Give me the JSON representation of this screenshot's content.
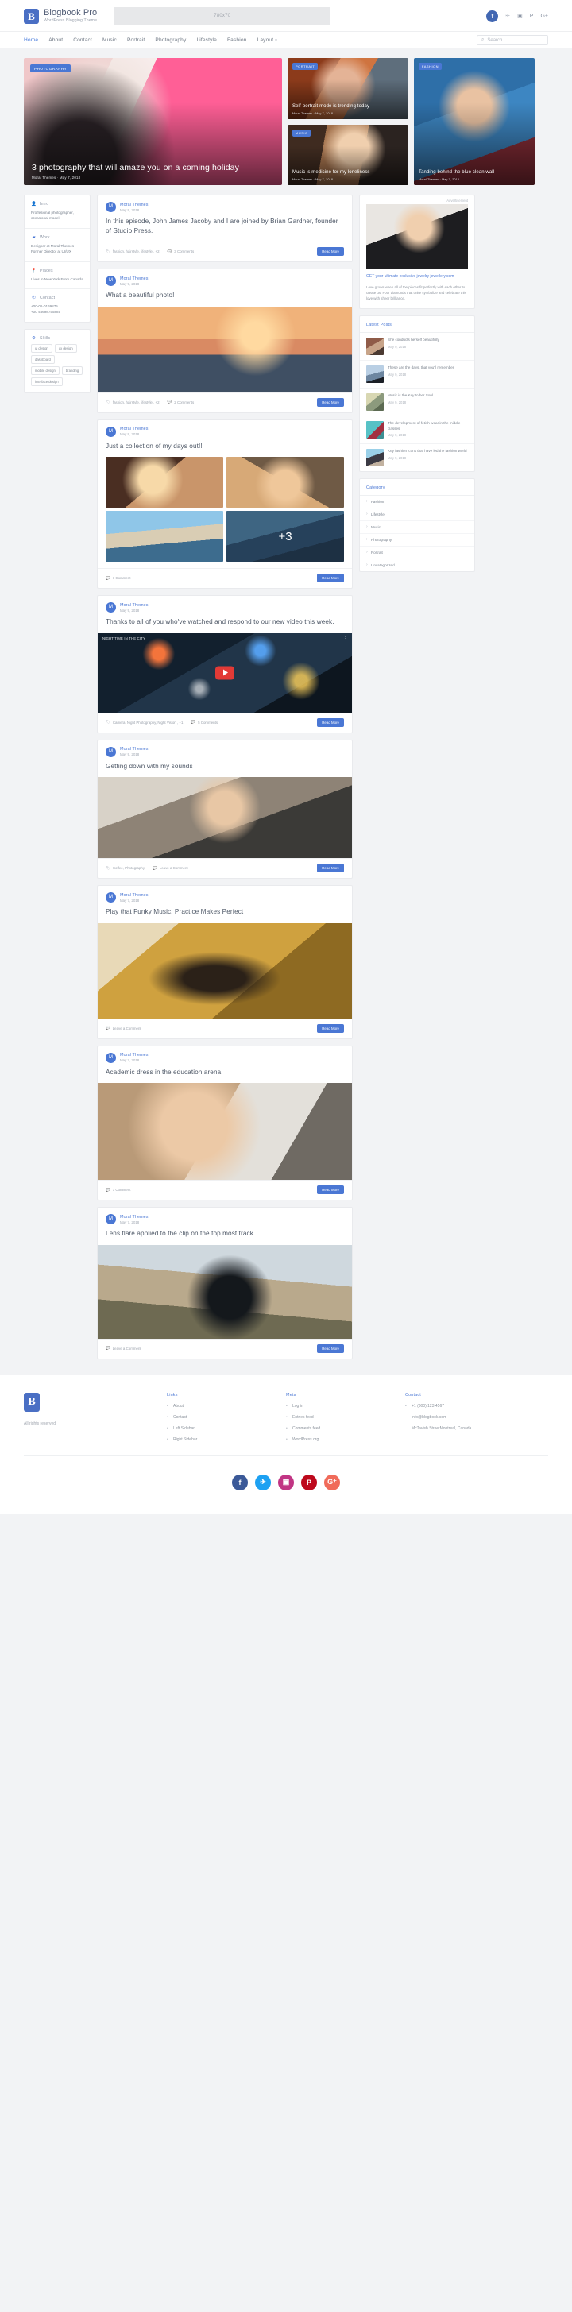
{
  "header": {
    "brand_title": "Blogbook Pro",
    "brand_sub": "WordPress Blogging Theme",
    "brand_mark": "B",
    "ad_placeholder": "780x70",
    "social": [
      {
        "name": "facebook-icon",
        "glyph": "f"
      },
      {
        "name": "twitter-icon",
        "glyph": "✈"
      },
      {
        "name": "instagram-icon",
        "glyph": "▣"
      },
      {
        "name": "pinterest-icon",
        "glyph": "P"
      },
      {
        "name": "google-plus-icon",
        "glyph": "G+"
      }
    ],
    "nav": [
      {
        "label": "Home",
        "active": true
      },
      {
        "label": "About",
        "active": false
      },
      {
        "label": "Contact",
        "active": false
      },
      {
        "label": "Music",
        "active": false
      },
      {
        "label": "Portrait",
        "active": false
      },
      {
        "label": "Photography",
        "active": false
      },
      {
        "label": "Lifestyle",
        "active": false
      },
      {
        "label": "Fashion",
        "active": false
      },
      {
        "label": "Layout",
        "active": false,
        "caret": true
      }
    ],
    "search_placeholder": "Search ..."
  },
  "hero": {
    "main": {
      "category": "PHOTOGRAPHY",
      "title": "3 photography that will amaze you on a coming holiday",
      "meta": "Moral Themes · May 7, 2018"
    },
    "portrait": {
      "category": "PORTRAIT",
      "title": "Self-portrait mode is trending today",
      "meta": "Moral Themes · May 7, 2018"
    },
    "music": {
      "category": "MUSIC",
      "title": "Music is medicine for my loneliness",
      "meta": "Moral Themes · May 7, 2018"
    },
    "fashion": {
      "category": "FASHION",
      "title": "Tanding behind the blue clean wall",
      "meta": "Moral Themes · May 7, 2018"
    }
  },
  "profile": {
    "sections": [
      {
        "icon": "user-icon",
        "label": "Intro",
        "text": "Proffesional photographer, occasional model."
      },
      {
        "icon": "briefcase-icon",
        "label": "Work",
        "text": "Designer at Moral Themes Former Director at UI/UX"
      },
      {
        "icon": "map-pin-icon",
        "label": "Places",
        "text": "Lives in New York From Canada"
      },
      {
        "icon": "phone-icon",
        "label": "Contact",
        "text": "+00-01-0169875\n+00 45698755885"
      }
    ],
    "skills_label": "Skills",
    "skills_icon": "gear-icon",
    "skills": [
      "ui design",
      "ux design",
      "dashboard",
      "mobile design",
      "branding",
      "interface design"
    ]
  },
  "posts": [
    {
      "author": "Moral Themes",
      "avatar": "M",
      "date": "May 9, 2018",
      "title": "In this episode, John James Jacoby and I are joined by Brian Gardner, founder of Studio Press.",
      "media": "none",
      "tags": "fashion, hairstyle, lifestyle , +2",
      "comments": "3 Comments",
      "readmore": "Read More"
    },
    {
      "author": "Moral Themes",
      "avatar": "M",
      "date": "May 9, 2018",
      "title": "What a beautiful photo!",
      "media": "sunset",
      "tags": "fashion, hairstyle, lifestyle , +2",
      "comments": "2 Comments",
      "readmore": "Read More"
    },
    {
      "author": "Moral Themes",
      "avatar": "M",
      "date": "May 9, 2018",
      "title": "Just a collection of my days out!!",
      "media": "gallery",
      "gallery_more": "+3",
      "tags": "",
      "comments": "1 Comment",
      "readmore": "Read More"
    },
    {
      "author": "Moral Themes",
      "avatar": "M",
      "date": "May 9, 2018",
      "title": "Thanks to all of you who've watched and respond to our new video this week.",
      "media": "video",
      "video_title": "NIGHT TIME IN THE CITY",
      "tags": "Camera, Night Photography, Night Vision , +1",
      "comments": "5 Comments",
      "readmore": "Read More"
    },
    {
      "author": "Moral Themes",
      "avatar": "M",
      "date": "May 9, 2018",
      "title": "Getting down with my sounds",
      "media": "cafe",
      "tags": "Coffee, Photography",
      "comments": "Leave a Comment",
      "readmore": "Read More"
    },
    {
      "author": "Moral Themes",
      "avatar": "M",
      "date": "May 7, 2018",
      "title": "Play that Funky Music, Practice Makes Perfect",
      "media": "sax",
      "tags": "",
      "comments": "Leave a Comment",
      "readmore": "Read More"
    },
    {
      "author": "Moral Themes",
      "avatar": "M",
      "date": "May 7, 2018",
      "title": "Academic dress in the education arena",
      "media": "academic",
      "tags": "",
      "comments": "1 Comment",
      "readmore": "Read More"
    },
    {
      "author": "Moral Themes",
      "avatar": "M",
      "date": "May 7, 2018",
      "title": "Lens flare applied to the clip on the top most track",
      "media": "lens",
      "tags": "",
      "comments": "Leave a Comment",
      "readmore": "Read More"
    }
  ],
  "sidebar": {
    "ad_label": "Advertisement",
    "ad_link": "GET your ultimate exclusive jewelry jewellery.com",
    "ad_text": "Love grows when all of the pieces fit perfectly with each other to create us. Four diamonds that unite symbolize and celebrate this love with sheer brilliance.",
    "latest_title": "Latest Posts",
    "latest": [
      {
        "title": "She conducts herself beautifully",
        "date": "May 9, 2018"
      },
      {
        "title": "These are the days, that you'll remember",
        "date": "May 9, 2018"
      },
      {
        "title": "Music is the Key to her Soul",
        "date": "May 9, 2018"
      },
      {
        "title": "The development of fetish wear in the middle classes",
        "date": "May 9, 2018"
      },
      {
        "title": "Key fashion icons that have led the fashion world",
        "date": "May 9, 2018"
      }
    ],
    "category_title": "Category",
    "categories": [
      "Fashion",
      "Lifestyle",
      "Music",
      "Photography",
      "Portrait",
      "Uncategorized"
    ]
  },
  "footer": {
    "logo_mark": "B",
    "rights": "All rights reserved.",
    "links_title": "Links",
    "links": [
      "About",
      "Contact",
      "Left Sidebar",
      "Right Sidebar"
    ],
    "meta_title": "Meta",
    "meta": [
      "Log in",
      "Entries feed",
      "Comments feed",
      "WordPress.org"
    ],
    "contact_title": "Contact",
    "contact": [
      "+1 (800) 123 4567",
      "info@blogbook.com",
      "McTavish StreetMontreal, Canada"
    ],
    "social": [
      {
        "name": "facebook-icon",
        "glyph": "f",
        "color": "#3b5998"
      },
      {
        "name": "twitter-icon",
        "glyph": "✈",
        "color": "#1da1f2"
      },
      {
        "name": "instagram-icon",
        "glyph": "▣",
        "color": "#c13584"
      },
      {
        "name": "pinterest-icon",
        "glyph": "P",
        "color": "#bd081c"
      },
      {
        "name": "google-plus-icon",
        "glyph": "G⁺",
        "color": "#f06b5a"
      }
    ]
  }
}
